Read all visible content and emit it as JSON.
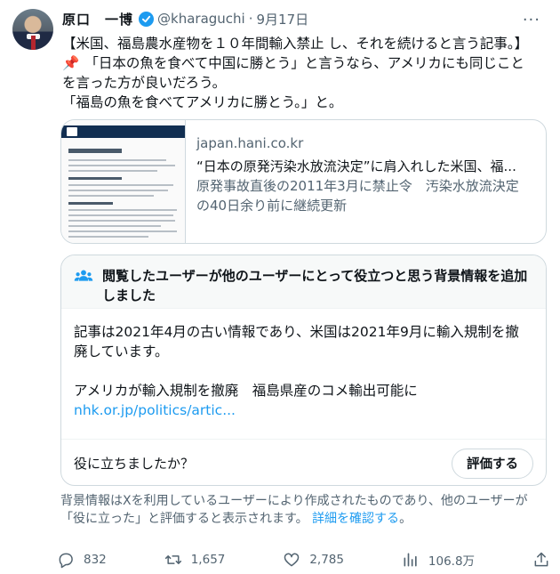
{
  "author": {
    "name": "原口　一博",
    "handle": "@kharaguchi",
    "separator": "·",
    "date": "9月17日"
  },
  "tweet": {
    "lines": [
      "【米国、福島農水産物を１０年間輸入禁止 し、それを続けると言う記事。】",
      "「日本の魚を食べて中国に勝とう」と言うなら、アメリカにも同じこと",
      "を言った方が良いだろう。",
      "「福島の魚を食べてアメリカに勝とう。」と。"
    ],
    "pin_emoji": "📌"
  },
  "link_card": {
    "domain": "japan.hani.co.kr",
    "title": "“日本の原発汚染水放流決定”に肩入れした米国、福...",
    "desc_line1": "原発事故直後の2011年3月に禁止令　汚染水放流決定",
    "desc_line2": "の40日余り前に継続更新"
  },
  "community_note": {
    "header": "閲覧したユーザーが他のユーザーにとって役立つと思う背景情報を追加しました",
    "body_line1": "記事は2021年4月の古い情報であり、米国は2021年9月に輸入規制を撤",
    "body_line2": "廃しています。",
    "link_title": "アメリカが輸入規制を撤廃　福島県産のコメ輸出可能に",
    "link_url": "nhk.or.jp/politics/artic...",
    "helpful_question": "役に立ちましたか？",
    "rate_button": "評価する"
  },
  "footnote": {
    "text": "背景情報はXを利用しているユーザーにより作成されたものであり、他のユーザーが「役に立った」と評価すると表示されます。",
    "link": "詳細を確認する",
    "suffix": "。"
  },
  "actions": {
    "replies": "832",
    "reposts": "1,657",
    "likes": "2,785",
    "views": "106.8万"
  },
  "colors": {
    "accent": "#1d9bf0",
    "text": "#0f1419",
    "muted": "#536471",
    "border": "#cfd9de"
  }
}
